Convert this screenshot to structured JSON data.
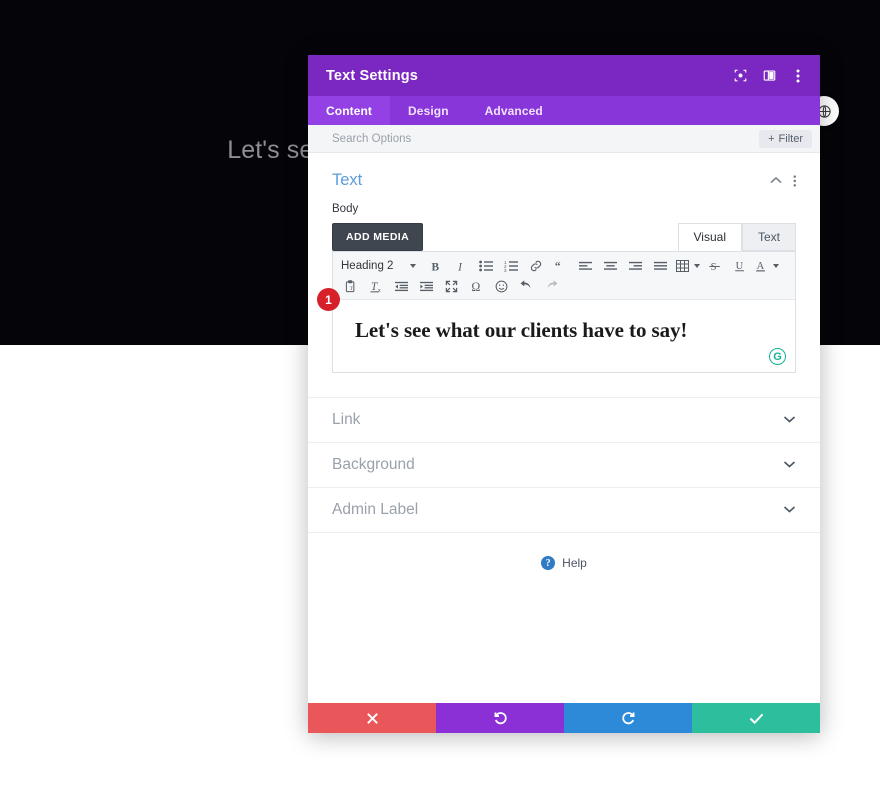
{
  "background_page": {
    "hero_text": "Let's see what our clients have to say!",
    "hero_bg_color": "#050509",
    "hero_text_color": "#8e8e93",
    "fab_icon": "globe-icon"
  },
  "modal": {
    "title": "Text Settings",
    "header_color": "#7b27c1",
    "tabbar_color": "#8835da",
    "header_icons": [
      {
        "name": "focus-preview-icon",
        "label": "Preview"
      },
      {
        "name": "layout-columns-icon",
        "label": "Layout"
      },
      {
        "name": "kebab-menu-icon",
        "label": "More options"
      }
    ],
    "tabs": [
      {
        "label": "Content",
        "active": true
      },
      {
        "label": "Design",
        "active": false
      },
      {
        "label": "Advanced",
        "active": false
      }
    ],
    "search": {
      "placeholder": "Search Options",
      "value": "",
      "filter_label": "Filter",
      "filter_icon": "plus-icon"
    },
    "text_section": {
      "title": "Text",
      "collapse_icon": "chevron-up-icon",
      "menu_icon": "kebab-menu-icon",
      "field_label": "Body",
      "add_media_label": "ADD MEDIA",
      "editor_tabs": [
        {
          "label": "Visual",
          "active": true
        },
        {
          "label": "Text",
          "active": false
        }
      ],
      "format_select": {
        "value": "Heading 2",
        "caret_icon": "caret-down-icon"
      },
      "toolbar_row1": [
        {
          "name": "bold-icon",
          "label": "Bold"
        },
        {
          "name": "italic-icon",
          "label": "Italic"
        },
        {
          "name": "bulleted-list-icon",
          "label": "Bulleted list"
        },
        {
          "name": "numbered-list-icon",
          "label": "Numbered list"
        },
        {
          "name": "link-icon",
          "label": "Insert link"
        },
        {
          "name": "blockquote-icon",
          "label": "Blockquote"
        },
        {
          "name": "align-left-icon",
          "label": "Align left"
        },
        {
          "name": "align-center-icon",
          "label": "Align center"
        },
        {
          "name": "align-right-icon",
          "label": "Align right"
        },
        {
          "name": "align-justify-icon",
          "label": "Justify"
        },
        {
          "name": "table-icon",
          "label": "Table"
        },
        {
          "name": "strikethrough-icon",
          "label": "Strikethrough"
        },
        {
          "name": "underline-icon",
          "label": "Underline"
        },
        {
          "name": "text-color-icon",
          "label": "Text color"
        }
      ],
      "toolbar_row2": [
        {
          "name": "paste-as-text-icon",
          "label": "Paste as text"
        },
        {
          "name": "clear-formatting-icon",
          "label": "Clear formatting"
        },
        {
          "name": "outdent-icon",
          "label": "Decrease indent"
        },
        {
          "name": "indent-icon",
          "label": "Increase indent"
        },
        {
          "name": "fullscreen-icon",
          "label": "Fullscreen"
        },
        {
          "name": "special-character-icon",
          "label": "Special character"
        },
        {
          "name": "emoji-icon",
          "label": "Emoji"
        },
        {
          "name": "undo-icon",
          "label": "Undo"
        },
        {
          "name": "redo-icon",
          "label": "Redo"
        }
      ],
      "content_html_text": "Let's see what our clients have to say!",
      "grammarly_badge": "G",
      "step_badge": "1"
    },
    "collapsed_sections": [
      {
        "label": "Link",
        "chevron": "chevron-down-icon"
      },
      {
        "label": "Background",
        "chevron": "chevron-down-icon"
      },
      {
        "label": "Admin Label",
        "chevron": "chevron-down-icon"
      }
    ],
    "help": {
      "label": "Help",
      "icon": "question-mark-icon"
    },
    "actions": [
      {
        "name": "close-button",
        "icon": "x-icon",
        "color": "#e9575a"
      },
      {
        "name": "undo-button",
        "icon": "undo-arrow-icon",
        "color": "#8b2fd6"
      },
      {
        "name": "redo-button",
        "icon": "redo-arrow-icon",
        "color": "#2d8ad8"
      },
      {
        "name": "save-button",
        "icon": "check-icon",
        "color": "#2dbe9e"
      }
    ]
  }
}
